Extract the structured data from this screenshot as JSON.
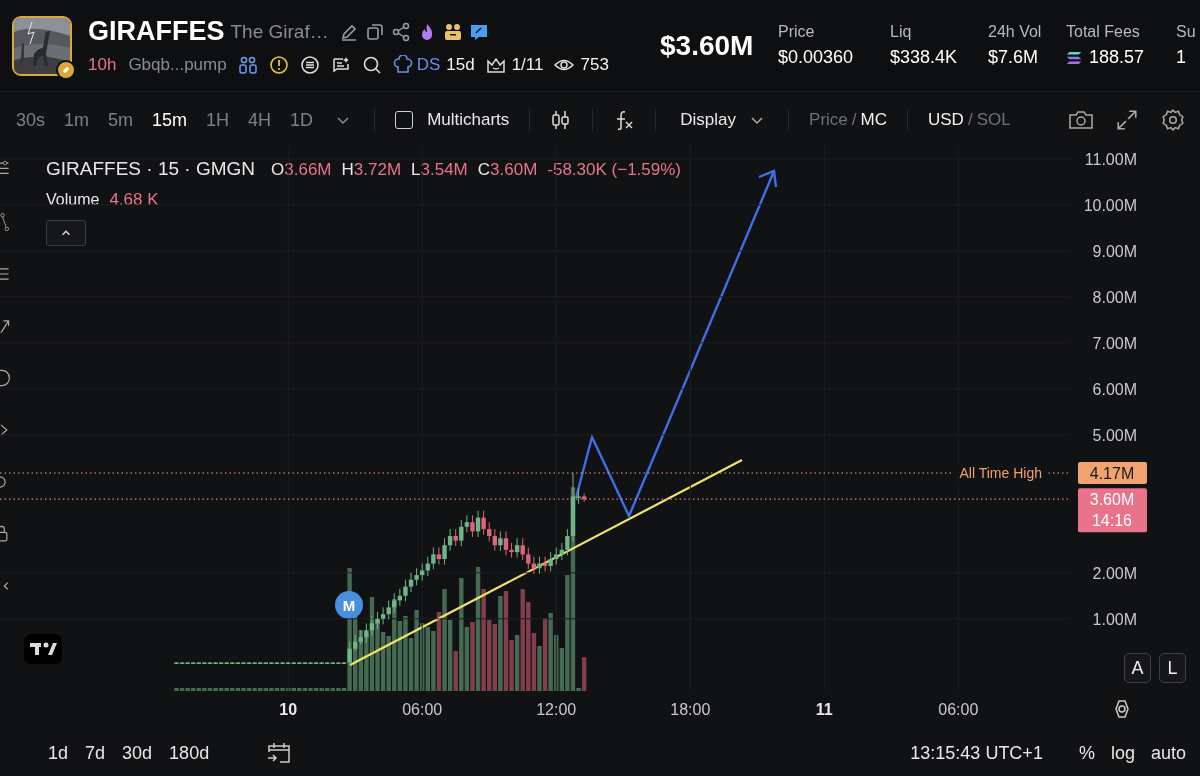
{
  "token": {
    "symbol": "GIRAFFES",
    "name": "The Giraf…",
    "age": "10h",
    "address": "Gbqb...pump",
    "ds_label": "DS",
    "ds_age": "15d",
    "rank": "1/11",
    "views": "753"
  },
  "market_cap": "$3.60M",
  "stats": [
    {
      "label": "Price",
      "value": "$0.00360",
      "kind": "plain"
    },
    {
      "label": "Liq",
      "value": "$338.4K",
      "kind": "plain"
    },
    {
      "label": "24h Vol",
      "value": "$7.6M",
      "kind": "plain"
    },
    {
      "label": "Total Fees",
      "value": "188.57",
      "kind": "sol"
    },
    {
      "label": "Su",
      "value": "1",
      "kind": "plain"
    }
  ],
  "intervals": [
    {
      "label": "30s",
      "selected": false
    },
    {
      "label": "1m",
      "selected": false
    },
    {
      "label": "5m",
      "selected": false
    },
    {
      "label": "15m",
      "selected": true
    },
    {
      "label": "1H",
      "selected": false
    },
    {
      "label": "4H",
      "selected": false
    },
    {
      "label": "1D",
      "selected": false
    }
  ],
  "multicharts": {
    "label": "Multicharts",
    "checked": false
  },
  "display": "Display",
  "price_mc": {
    "separator": "/",
    "options": [
      {
        "label": "Price",
        "selected": false
      },
      {
        "label": "MC",
        "selected": true
      }
    ]
  },
  "currency": {
    "separator": "/",
    "options": [
      {
        "label": "USD",
        "selected": true
      },
      {
        "label": "SOL",
        "selected": false
      }
    ]
  },
  "legend": {
    "title": "GIRAFFES · 15 · GMGN",
    "ohlc": [
      {
        "key": "O",
        "value": "3.66M"
      },
      {
        "key": "H",
        "value": "3.72M"
      },
      {
        "key": "L",
        "value": "3.54M"
      },
      {
        "key": "C",
        "value": "3.60M"
      }
    ],
    "change": "-58.30K (−1.59%)",
    "volume_label": "Volume",
    "volume_value": "4.68 K"
  },
  "chart": {
    "marker_label": "M",
    "hour_labels": [
      [
        "06:00",
        "12:00",
        "18:00"
      ],
      [
        "06:00"
      ]
    ],
    "price_tags": [
      {
        "text": "4.17M"
      },
      {
        "text": "3.60M",
        "sub": "14:16"
      }
    ],
    "chart_data": {
      "type": "candlestick",
      "grid": true,
      "xlim": [
        9.4625,
        11.4583
      ],
      "ylim": [
        -0.57,
        11.28
      ],
      "x": [
        9.79167,
        9.80208,
        9.8125,
        9.82292,
        9.83333,
        9.84375,
        9.85417,
        9.86458,
        9.875,
        9.88542,
        9.89583,
        9.90625,
        9.91667,
        9.92708,
        9.9375,
        9.94792,
        9.95833,
        9.96875,
        9.97917,
        9.98958,
        10,
        10.01042,
        10.02083,
        10.03125,
        10.04167,
        10.05208,
        10.0625,
        10.07292,
        10.08333,
        10.09375,
        10.10417,
        10.11458,
        10.125,
        10.13542,
        10.14583,
        10.15625,
        10.16667,
        10.17708,
        10.1875,
        10.19792,
        10.20833,
        10.21875,
        10.22917,
        10.23958,
        10.25,
        10.26042,
        10.27083,
        10.28125,
        10.29167,
        10.30208,
        10.3125,
        10.32292,
        10.33333,
        10.34375,
        10.35417,
        10.36458,
        10.375,
        10.38542,
        10.39583,
        10.40625,
        10.41667,
        10.42708,
        10.4375,
        10.44792,
        10.45833,
        10.46875,
        10.47917,
        10.48958,
        10.5,
        10.51042,
        10.52083,
        10.53125,
        10.54167,
        10.55208
      ],
      "ohlc": [
        [
          0.05,
          0.06,
          0.04,
          0.05
        ],
        [
          0.05,
          0.06,
          0.04,
          0.05
        ],
        [
          0.05,
          0.06,
          0.04,
          0.05
        ],
        [
          0.05,
          0.06,
          0.04,
          0.05
        ],
        [
          0.05,
          0.06,
          0.04,
          0.05
        ],
        [
          0.05,
          0.06,
          0.04,
          0.05
        ],
        [
          0.05,
          0.06,
          0.04,
          0.05
        ],
        [
          0.05,
          0.06,
          0.04,
          0.05
        ],
        [
          0.05,
          0.06,
          0.04,
          0.05
        ],
        [
          0.05,
          0.06,
          0.04,
          0.05
        ],
        [
          0.05,
          0.06,
          0.04,
          0.05
        ],
        [
          0.05,
          0.06,
          0.04,
          0.05
        ],
        [
          0.05,
          0.06,
          0.04,
          0.05
        ],
        [
          0.05,
          0.06,
          0.04,
          0.05
        ],
        [
          0.05,
          0.06,
          0.04,
          0.05
        ],
        [
          0.05,
          0.06,
          0.04,
          0.05
        ],
        [
          0.05,
          0.06,
          0.04,
          0.05
        ],
        [
          0.05,
          0.06,
          0.04,
          0.05
        ],
        [
          0.05,
          0.06,
          0.04,
          0.05
        ],
        [
          0.05,
          0.06,
          0.04,
          0.05
        ],
        [
          0.05,
          0.06,
          0.04,
          0.05
        ],
        [
          0.05,
          0.06,
          0.04,
          0.05
        ],
        [
          0.05,
          0.06,
          0.04,
          0.05
        ],
        [
          0.05,
          0.06,
          0.04,
          0.05
        ],
        [
          0.05,
          0.06,
          0.04,
          0.05
        ],
        [
          0.05,
          0.06,
          0.04,
          0.05
        ],
        [
          0.05,
          0.06,
          0.04,
          0.05
        ],
        [
          0.05,
          0.06,
          0.04,
          0.05
        ],
        [
          0.05,
          0.06,
          0.04,
          0.05
        ],
        [
          0.05,
          0.06,
          0.04,
          0.05
        ],
        [
          0.05,
          0.06,
          0.04,
          0.05
        ],
        [
          0.05,
          0.5,
          0.03,
          0.35
        ],
        [
          0.35,
          0.65,
          0.3,
          0.5
        ],
        [
          0.5,
          0.75,
          0.45,
          0.6
        ],
        [
          0.6,
          0.9,
          0.48,
          0.75
        ],
        [
          0.75,
          1.05,
          0.63,
          0.9
        ],
        [
          0.9,
          1.15,
          0.78,
          1.0
        ],
        [
          1.0,
          1.25,
          0.88,
          1.1
        ],
        [
          1.1,
          1.4,
          0.98,
          1.25
        ],
        [
          1.25,
          1.55,
          1.13,
          1.4
        ],
        [
          1.4,
          1.65,
          1.28,
          1.5
        ],
        [
          1.5,
          1.85,
          1.38,
          1.7
        ],
        [
          1.7,
          2.0,
          1.58,
          1.85
        ],
        [
          1.85,
          2.1,
          1.73,
          1.95
        ],
        [
          1.95,
          2.2,
          1.83,
          2.05
        ],
        [
          2.05,
          2.35,
          1.93,
          2.2
        ],
        [
          2.2,
          2.55,
          2.08,
          2.4
        ],
        [
          2.4,
          2.55,
          2.18,
          2.3
        ],
        [
          2.3,
          2.75,
          2.18,
          2.6
        ],
        [
          2.6,
          2.95,
          2.48,
          2.8
        ],
        [
          2.8,
          2.95,
          2.58,
          2.7
        ],
        [
          2.7,
          3.15,
          2.58,
          3.0
        ],
        [
          3.0,
          3.25,
          2.88,
          3.1
        ],
        [
          3.1,
          3.25,
          2.78,
          2.9
        ],
        [
          2.9,
          3.35,
          2.78,
          3.2
        ],
        [
          3.2,
          3.35,
          2.83,
          2.95
        ],
        [
          2.95,
          3.1,
          2.68,
          2.8
        ],
        [
          2.8,
          2.95,
          2.48,
          2.6
        ],
        [
          2.6,
          2.9,
          2.48,
          2.75
        ],
        [
          2.75,
          2.9,
          2.38,
          2.5
        ],
        [
          2.5,
          2.65,
          2.33,
          2.45
        ],
        [
          2.45,
          2.75,
          2.33,
          2.6
        ],
        [
          2.6,
          2.75,
          2.28,
          2.4
        ],
        [
          2.4,
          2.55,
          2.08,
          2.2
        ],
        [
          2.2,
          2.35,
          1.98,
          2.1
        ],
        [
          2.1,
          2.35,
          1.98,
          2.2
        ],
        [
          2.2,
          2.35,
          2.03,
          2.15
        ],
        [
          2.15,
          2.45,
          2.03,
          2.3
        ],
        [
          2.3,
          2.55,
          2.18,
          2.4
        ],
        [
          2.4,
          2.65,
          2.28,
          2.5
        ],
        [
          2.5,
          2.95,
          2.38,
          2.8
        ],
        [
          2.8,
          4.17,
          2.68,
          3.66
        ],
        [
          3.66,
          3.85,
          3.5,
          3.66
        ],
        [
          3.66,
          3.72,
          3.54,
          3.6
        ]
      ],
      "xticks": [
        {
          "value": 10,
          "label": "10"
        },
        {
          "value": 11,
          "label": "11"
        }
      ],
      "yticks": [
        {
          "value": 1,
          "label": "1.00M"
        },
        {
          "value": 2,
          "label": "2.00M"
        },
        {
          "value": 5,
          "label": "5.00M"
        },
        {
          "value": 6,
          "label": "6.00M"
        },
        {
          "value": 7,
          "label": "7.00M"
        },
        {
          "value": 8,
          "label": "8.00M"
        },
        {
          "value": 9,
          "label": "9.00M"
        },
        {
          "value": 10,
          "label": "10.00M"
        },
        {
          "value": 11,
          "label": "11.00M"
        }
      ],
      "ref_lines": [
        {
          "axis": "y",
          "value": 4.17,
          "label": "All Time High",
          "color": "#f0a36e"
        },
        {
          "axis": "y",
          "value": 3.6,
          "color": "#e8738a"
        }
      ]
    }
  },
  "scale_buttons": [
    "A",
    "L"
  ],
  "ranges": [
    "1d",
    "7d",
    "30d",
    "180d"
  ],
  "clock": "13:15:43 UTC+1",
  "scale_options": [
    "%",
    "log",
    "auto"
  ]
}
